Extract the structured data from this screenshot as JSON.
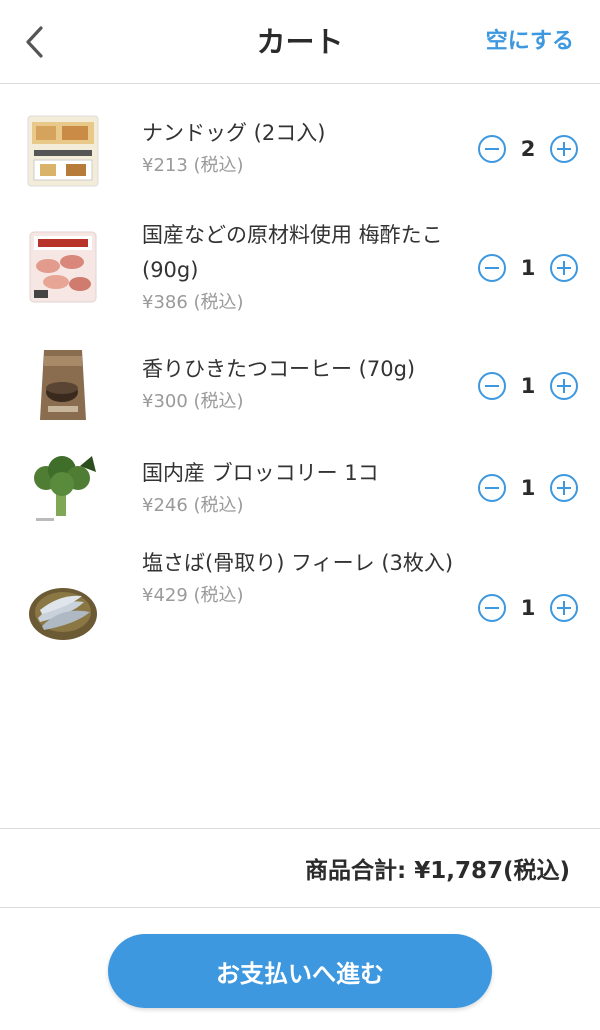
{
  "header": {
    "title": "カート",
    "clear_label": "空にする",
    "back_icon": "chevron-left-icon"
  },
  "items": [
    {
      "name": "ナンドッグ (2コ入)",
      "price": "¥213 (税込)",
      "quantity": "2",
      "thumb": "nan-dog-thumb"
    },
    {
      "name": "国産などの原材料使用 梅酢たこ (90g)",
      "price": "¥386 (税込)",
      "quantity": "1",
      "thumb": "umezu-tako-thumb"
    },
    {
      "name": "香りひきたつコーヒー (70g)",
      "price": "¥300 (税込)",
      "quantity": "1",
      "thumb": "coffee-thumb"
    },
    {
      "name": "国内産 ブロッコリー 1コ",
      "price": "¥246 (税込)",
      "quantity": "1",
      "thumb": "broccoli-thumb"
    },
    {
      "name": "塩さば(骨取り) フィーレ (3枚入)",
      "price": "¥429 (税込)",
      "quantity": "1",
      "thumb": "saba-thumb"
    }
  ],
  "summary": {
    "total_label": "商品合計:",
    "total_value": "¥1,787(税込)"
  },
  "checkout": {
    "label": "お支払いへ進む"
  },
  "colors": {
    "accent": "#3d98df",
    "text": "#333333",
    "muted": "#9a9a9a"
  }
}
